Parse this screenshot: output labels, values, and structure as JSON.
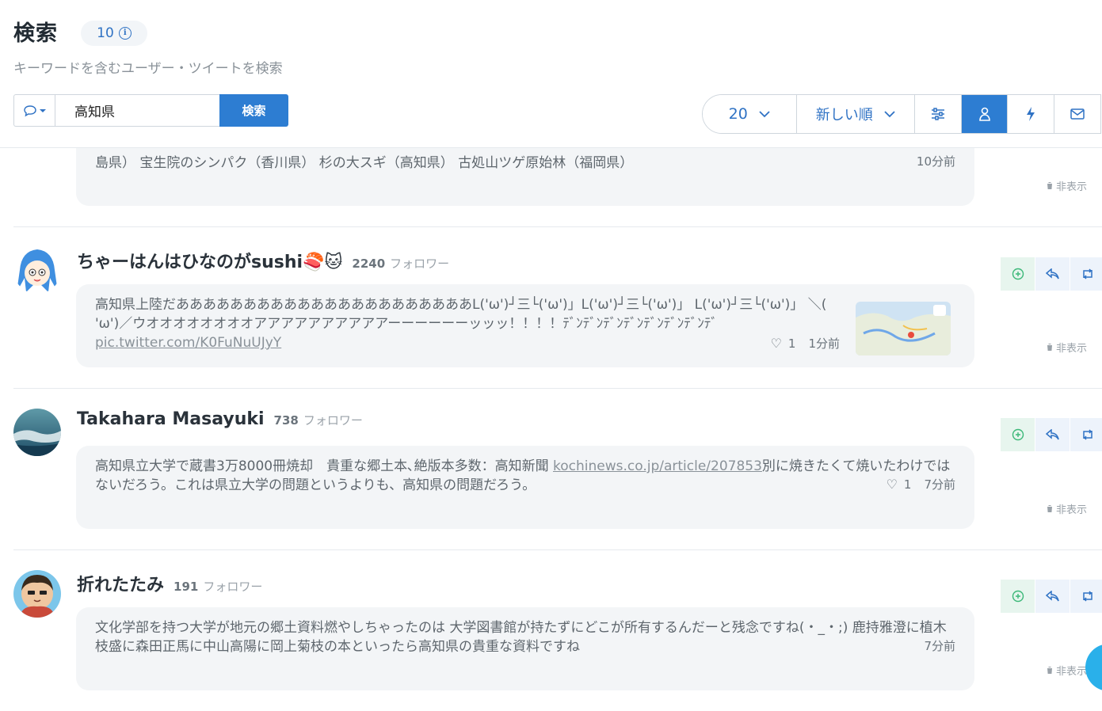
{
  "header": {
    "title": "検索",
    "count": "10",
    "subtitle": "キーワードを含むユーザー・ツイートを検索"
  },
  "search": {
    "type_icon": "speech-bubble-icon",
    "query": "高知県",
    "button_label": "検索"
  },
  "toolbar": {
    "count_label": "20",
    "sort_label": "新しい順",
    "icons": [
      "sliders-icon",
      "user-icon",
      "lightning-icon",
      "mail-icon"
    ],
    "active_icon": "user-icon"
  },
  "tweets": [
    {
      "partial_text": "島県） 宝生院のシンパク（香川県） 杉の大スギ（高知県） 古処山ツゲ原始林（福岡県）",
      "time": "10分前",
      "hide_label": "非表示"
    },
    {
      "user": "ちゃーはんはひなのがsushi🍣🐱",
      "followers": "2240",
      "followers_label": "フォロワー",
      "text": "高知県上陸だああああああああああああああああああああああL('ω')┘三└('ω')」L('ω')┘三└('ω')」 L('ω')┘三└('ω')」 ＼( 'ω')／ウオオオオオオオオアアアアアアアアアアーーーーーーッッッ！！！！ﾃﾞﾝﾃﾞﾝﾃﾞﾝﾃﾞﾝﾃﾞﾝﾃﾞﾝﾃﾞﾝﾃﾞ ",
      "link": "pic.twitter.com/K0FuNuUJyY",
      "likes": "1",
      "time": "1分前",
      "hide_label": "非表示"
    },
    {
      "user": "Takahara Masayuki",
      "followers": "738",
      "followers_label": "フォロワー",
      "text_before": "高知県立大学で蔵書3万8000冊焼却　貴重な郷土本､絶版本多数：高知新聞 ",
      "link": "kochinews.co.jp/article/207853",
      "text_after": "別に焼きたくて焼いたわけではないだろう。これは県立大学の問題というよりも、高知県の問題だろう。",
      "likes": "1",
      "time": "7分前",
      "hide_label": "非表示"
    },
    {
      "user": "折れたたみ",
      "followers": "191",
      "followers_label": "フォロワー",
      "text": "文化学部を持つ大学が地元の郷土資料燃やしちゃったのは 大学図書館が持たずにどこが所有するんだーと残念ですね(・_・;) 鹿持雅澄に植木枝盛に森田正馬に中山高陽に岡上菊枝の本といったら高知県の貴重な資料ですね",
      "time": "7分前",
      "hide_label": "非表示"
    }
  ],
  "colors": {
    "accent": "#2d7dd2",
    "follow_bg": "#e7f5ee",
    "follow_icon": "#3cb878",
    "action_bg": "#edf3fb",
    "action_icon": "#2f72c4"
  }
}
